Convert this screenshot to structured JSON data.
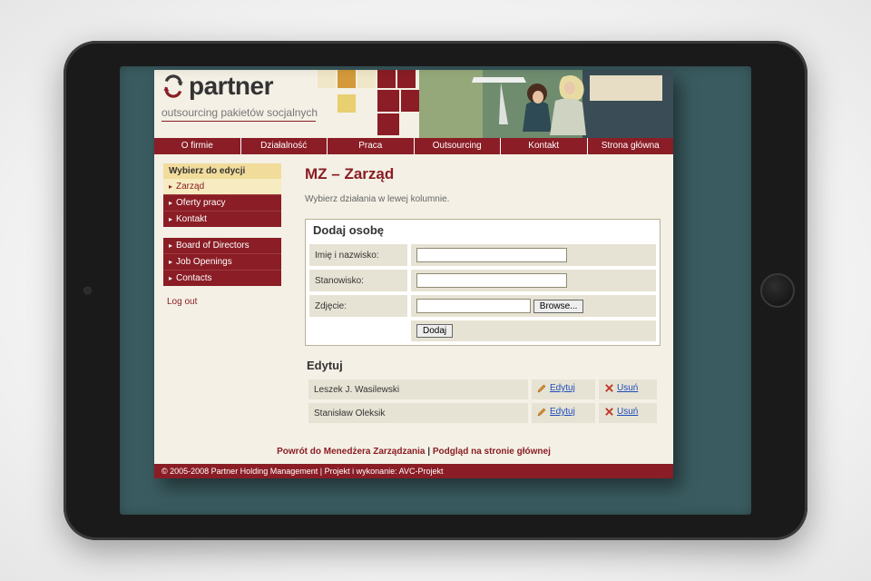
{
  "logo_word": "partner",
  "tagline": "outsourcing pakietów socjalnych",
  "nav": [
    "O firmie",
    "Działalność",
    "Praca",
    "Outsourcing",
    "Kontakt",
    "Strona główna"
  ],
  "side": {
    "title": "Wybierz do edycji",
    "groupA": [
      {
        "label": "Zarząd",
        "selected": true
      },
      {
        "label": "Oferty pracy"
      },
      {
        "label": "Kontakt"
      }
    ],
    "groupB": [
      {
        "label": "Board of Directors"
      },
      {
        "label": "Job Openings"
      },
      {
        "label": "Contacts"
      }
    ],
    "logout": "Log out"
  },
  "main": {
    "title": "MZ – Zarząd",
    "hint": "Wybierz działania w lewej kolumnie.",
    "add_title": "Dodaj osobę",
    "lab_name": "Imię i nazwisko:",
    "lab_position": "Stanowisko:",
    "lab_photo": "Zdjęcie:",
    "browse": "Browse...",
    "submit": "Dodaj",
    "edit_title": "Edytuj",
    "rows": [
      {
        "name": "Leszek J. Wasilewski"
      },
      {
        "name": "Stanisław Oleksik"
      }
    ],
    "edit_link": "Edytuj",
    "del_link": "Usuń"
  },
  "bottom": {
    "back": "Powrót do Menedżera Zarządzania",
    "sep": " | ",
    "preview": "Podgląd na stronie głównej"
  },
  "footer": {
    "copy": "© 2005-2008 Partner Holding Management",
    "sep": "  |  Projekt i wykonanie: ",
    "credit": "AVC-Projekt"
  }
}
